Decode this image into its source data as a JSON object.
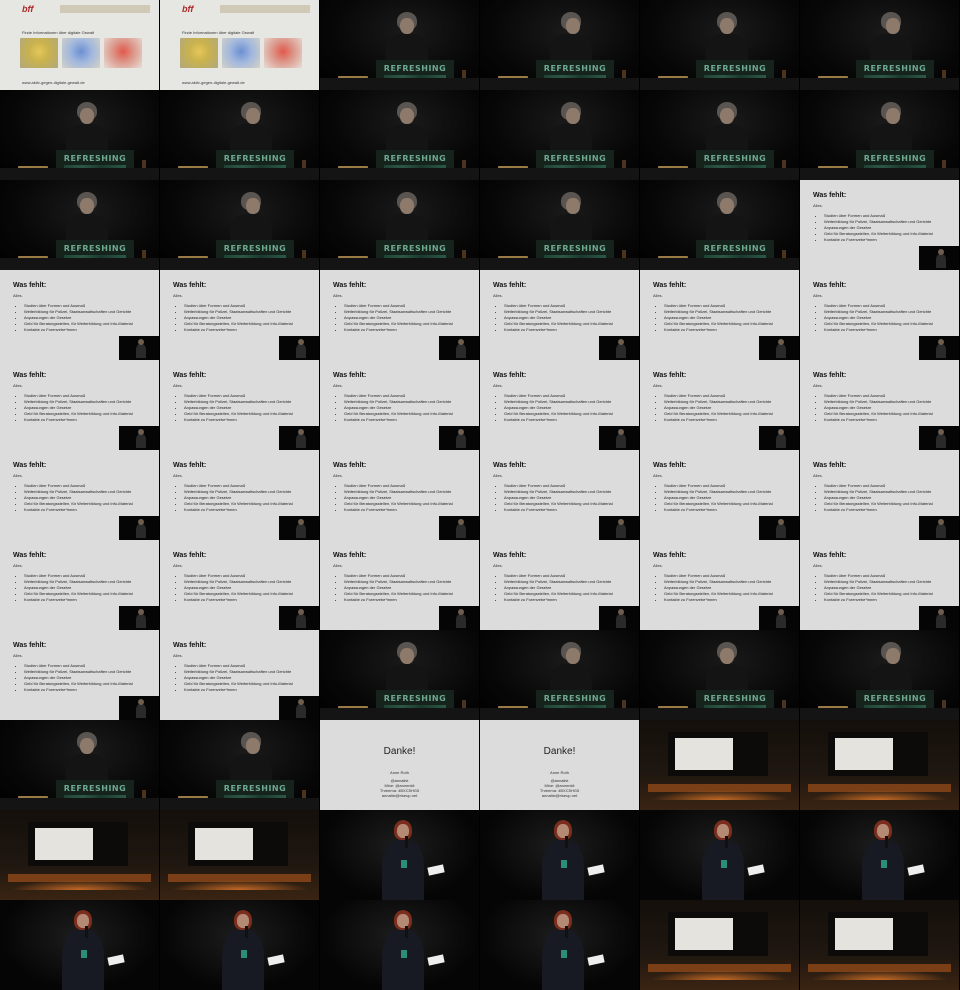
{
  "web": {
    "logo": "bff",
    "intro_text": "Finde Informationen über digitale Gewalt",
    "footer_url": "www.aktiv-gegen-digitale-gewalt.de"
  },
  "stage": {
    "lectern_label": "REFRESHING"
  },
  "slide": {
    "title": "Was fehlt:",
    "subtitle": "Alles.",
    "bullets": [
      "Studien über Formen und Ausmaß",
      "Weiterbildung für Polizei, Staatsanwaltschaften und Gerichte",
      "Anpassungen der Gesetze",
      "Geld für Beratungsstellen, für Weiterbildung und Info-Material",
      "Kontakte zu Forenvebe*innen"
    ]
  },
  "thanks": {
    "title": "Danke!",
    "name": "Anne Roth",
    "contacts": [
      "@annalist",
      "Mine: @annenkit",
      "Threema: 4BXC5HG5",
      "annalist@riseup.net"
    ]
  },
  "colors": {
    "background": "#000000",
    "slide_bg": "#dcdcdc",
    "lectern_text": "#6fa98f",
    "stage_glow": "#c46a26"
  }
}
